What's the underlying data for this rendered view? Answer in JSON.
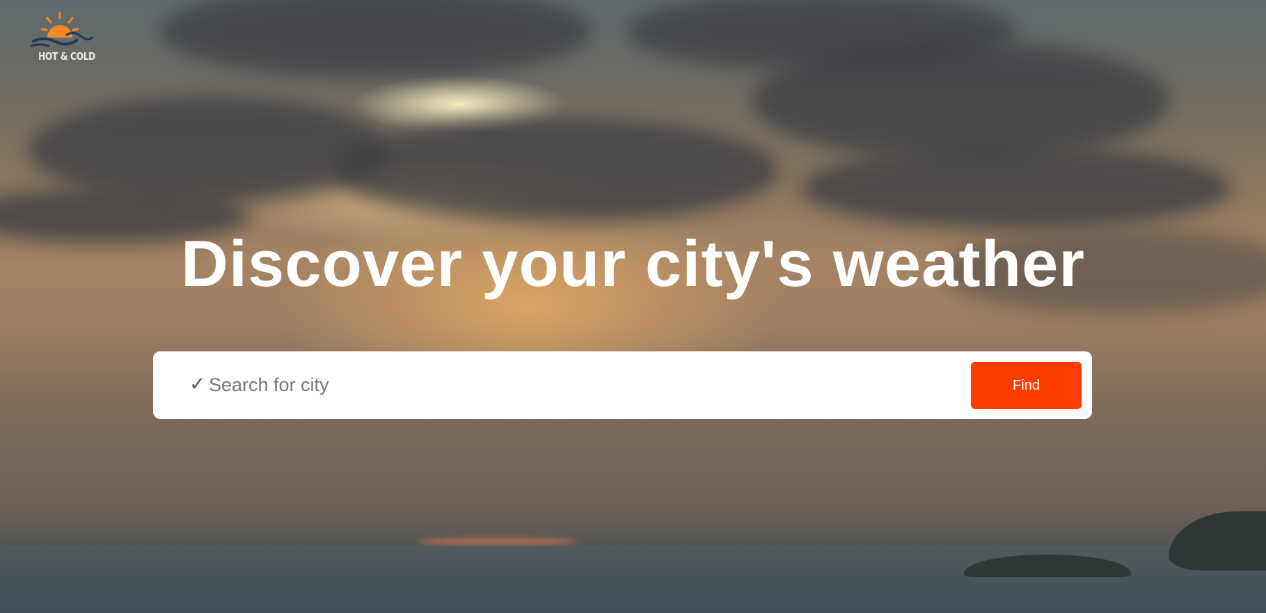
{
  "brand": {
    "logo_text": "HOT & COLD",
    "logo_icon": "sun-over-waves-icon",
    "sun_color": "#f08a24",
    "wave_color": "#1f3b5c"
  },
  "hero": {
    "headline": "Discover your city's weather",
    "background": "sunset-sky-over-sea-photo"
  },
  "search": {
    "check_glyph": "✓",
    "placeholder": "Search for city",
    "value": "",
    "button_label": "Find",
    "button_color": "#ff3d00"
  }
}
